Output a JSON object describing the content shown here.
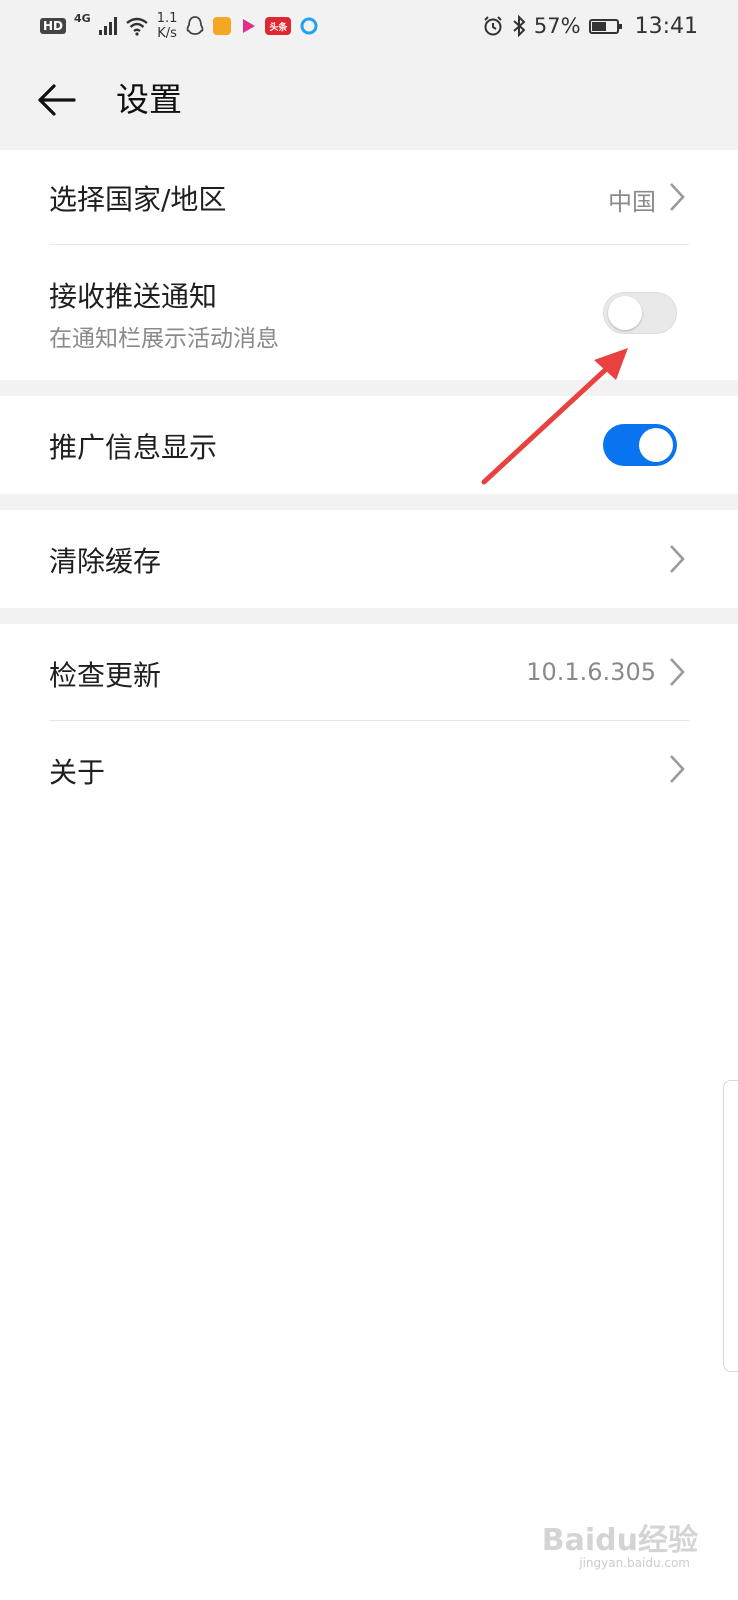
{
  "status_bar": {
    "hd": "HD",
    "network": "4G",
    "speed_value": "1.1",
    "speed_unit": "K/s",
    "app_icons": [
      "qq-icon",
      "dog-app-icon",
      "video-app-icon",
      "toutiao-icon",
      "browser-icon"
    ],
    "toutiao_label": "头条",
    "battery_percent": "57%",
    "battery_level": 0.57,
    "time": "13:41"
  },
  "header": {
    "title": "设置"
  },
  "settings": {
    "region": {
      "label": "选择国家/地区",
      "value": "中国"
    },
    "push": {
      "label": "接收推送通知",
      "sub": "在通知栏展示活动消息",
      "enabled": false
    },
    "promo": {
      "label": "推广信息显示",
      "enabled": true
    },
    "cache": {
      "label": "清除缓存"
    },
    "update": {
      "label": "检查更新",
      "value": "10.1.6.305"
    },
    "about": {
      "label": "关于"
    }
  },
  "watermark": {
    "text": "Baidu经验",
    "url": "jingyan.baidu.com"
  },
  "colors": {
    "accent": "#0a74f0",
    "annotation": "#e8413f",
    "page_bg": "#f2f2f2"
  }
}
